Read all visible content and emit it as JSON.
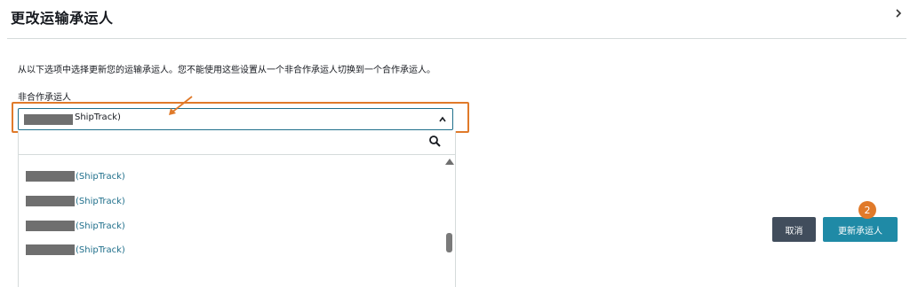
{
  "dialog": {
    "title": "更改运输承运人",
    "description": "从以下选项中选择更新您的运输承运人。您不能使用这些设置从一个非合作承运人切换到一个合作承运人。",
    "carrier_label": "非合作承运人"
  },
  "select": {
    "selected_value": "ShipTrack)"
  },
  "dropdown": {
    "options": [
      {
        "label": "(ShipTrack)"
      },
      {
        "label": "(ShipTrack)"
      },
      {
        "label": "(ShipTrack)"
      },
      {
        "label": "(ShipTrack)"
      }
    ]
  },
  "footer": {
    "cancel_label": "取消",
    "update_label": "更新承运人",
    "step_badge": "2"
  },
  "colors": {
    "accent": "#1f8aa6",
    "highlight": "#e07a2a",
    "link": "#1f6f8b",
    "dark_button": "#414d5c"
  }
}
